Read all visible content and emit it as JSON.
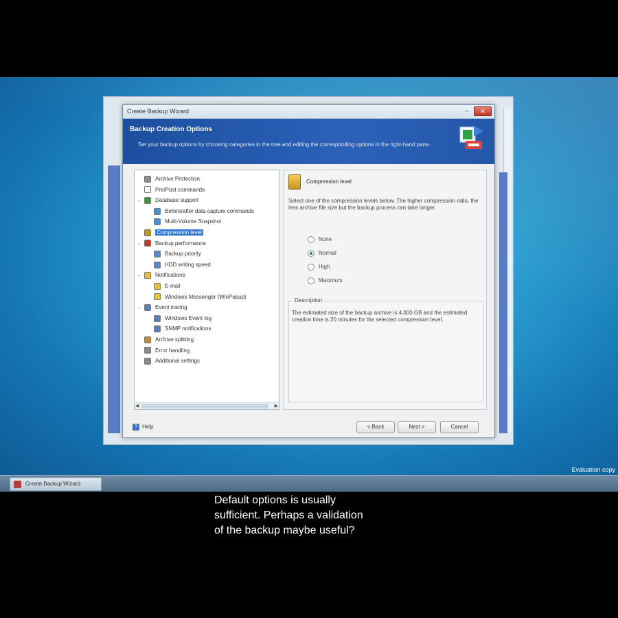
{
  "dialog": {
    "title": "Create Backup Wizard",
    "close_glyph": "✕",
    "min_glyph": "–",
    "banner_heading": "Backup Creation Options",
    "banner_subtitle": "Set your backup options by choosing categories in the tree and editing the corresponding options in the right-hand pane."
  },
  "tree": {
    "items": [
      {
        "label": "Archive Protection",
        "icon_color": "#8c8c8c"
      },
      {
        "label": "Pre/Post commands",
        "icon_color": "#ffffff"
      },
      {
        "label": "Database support",
        "icon_color": "#3a9a3a"
      },
      {
        "label": "Before/after data capture commands",
        "icon_color": "#4a8fd0"
      },
      {
        "label": "Multi-Volume Snapshot",
        "icon_color": "#4a8fd0"
      },
      {
        "label": "Compression level",
        "icon_color": "#c9941f"
      },
      {
        "label": "Backup performance",
        "icon_color": "#c0392b"
      },
      {
        "label": "Backup priority",
        "icon_color": "#5a86c9"
      },
      {
        "label": "HDD writing speed",
        "icon_color": "#5a86c9"
      },
      {
        "label": "Notifications",
        "icon_color": "#e6c13a"
      },
      {
        "label": "E-mail",
        "icon_color": "#e6c13a"
      },
      {
        "label": "Windows Messenger (WinPopup)",
        "icon_color": "#e6c13a"
      },
      {
        "label": "Event tracing",
        "icon_color": "#5a7fb0"
      },
      {
        "label": "Windows Event log",
        "icon_color": "#5a7fb0"
      },
      {
        "label": "SNMP notifications",
        "icon_color": "#5a7fb0"
      },
      {
        "label": "Archive splitting",
        "icon_color": "#c58a3a"
      },
      {
        "label": "Error handling",
        "icon_color": "#8a8a8a"
      },
      {
        "label": "Additional settings",
        "icon_color": "#8a8a8a"
      }
    ],
    "selected_index": 5
  },
  "pane": {
    "title": "Compression level",
    "intro": "Select one of the compression levels below. The higher compression ratio, the less archive file size but the backup process can take longer.",
    "options": [
      "None",
      "Normal",
      "High",
      "Maximum"
    ],
    "selected_option": 1,
    "description_legend": "Description",
    "description_text": "The estimated size of the backup archive is 4.000 GB and the estimated creation time is 20 minutes for the selected compression level."
  },
  "footer": {
    "help_label": "Help",
    "back_label": "< Back",
    "next_label": "Next >",
    "cancel_label": "Cancel"
  },
  "taskbar": {
    "task_label": "Create Backup Wizard",
    "eval_text": "Evaluation copy"
  },
  "caption": {
    "line1": "Default options is usually",
    "line2": "sufficient. Perhaps a validation",
    "line3": "of the backup maybe useful?"
  }
}
